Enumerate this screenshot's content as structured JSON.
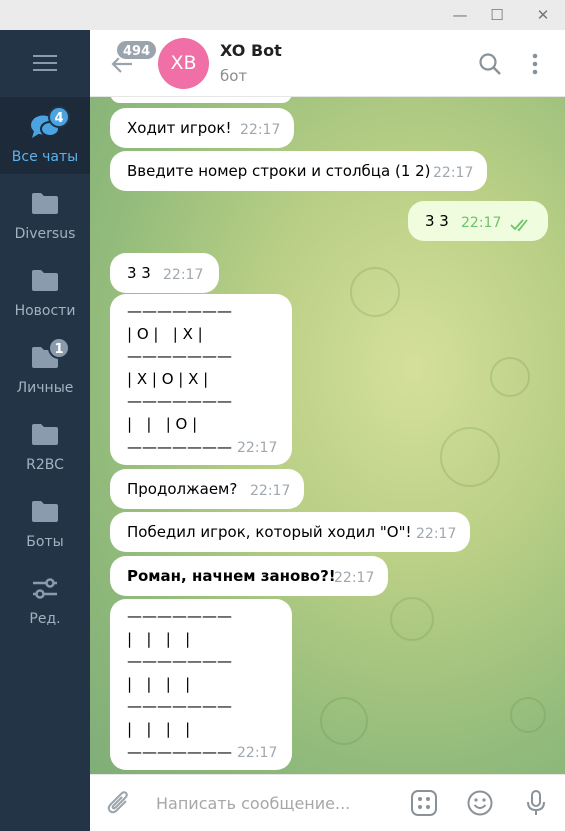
{
  "window": {
    "minimize": "—",
    "maximize": "☐",
    "close": "✕"
  },
  "sidebar": {
    "folders": [
      {
        "label": "Все чаты",
        "badge": "4",
        "icon": "chats-icon"
      },
      {
        "label": "Diversus",
        "icon": "folder-icon"
      },
      {
        "label": "Новости",
        "icon": "folder-icon"
      },
      {
        "label": "Личные",
        "badge": "1",
        "icon": "folder-icon"
      },
      {
        "label": "R2BC",
        "icon": "folder-icon"
      },
      {
        "label": "Боты",
        "icon": "folder-icon"
      },
      {
        "label": "Ред.",
        "icon": "edit-sliders-icon"
      }
    ]
  },
  "header": {
    "unread_count": "494",
    "avatar_initials": "XB",
    "title": "XO Bot",
    "subtitle": "бот"
  },
  "messages": [
    {
      "text": "Ходит игрок!",
      "time": "22:17",
      "direction": "in"
    },
    {
      "text": "Введите номер строки и столбца (1 2)",
      "time": "22:17",
      "direction": "in"
    },
    {
      "text": "3 3",
      "time": "22:17",
      "direction": "out",
      "status": "read"
    },
    {
      "text": "3 3",
      "time": "22:17",
      "direction": "in"
    },
    {
      "text": "———————\n| O |   | X |\n———————\n| X | O | X |\n———————\n|   |   | O |\n———————",
      "time": "22:17",
      "direction": "in"
    },
    {
      "text": "Продолжаем?",
      "time": "22:17",
      "direction": "in"
    },
    {
      "text": "Победил игрок, который ходил \"О\"!",
      "time": "22:17",
      "direction": "in"
    },
    {
      "text": "Роман, начнем заново?!",
      "time": "22:17",
      "direction": "in",
      "bold": true
    },
    {
      "text": "———————\n|   |   |   |\n———————\n|   |   |   |\n———————\n|   |   |   |\n———————",
      "time": "22:17",
      "direction": "in"
    }
  ],
  "composer": {
    "placeholder": "Написать сообщение..."
  },
  "colors": {
    "sidebar_bg": "#233447",
    "accent": "#4ba3e2",
    "outgoing_bubble": "#effdde",
    "avatar": "#ef6fa6"
  }
}
